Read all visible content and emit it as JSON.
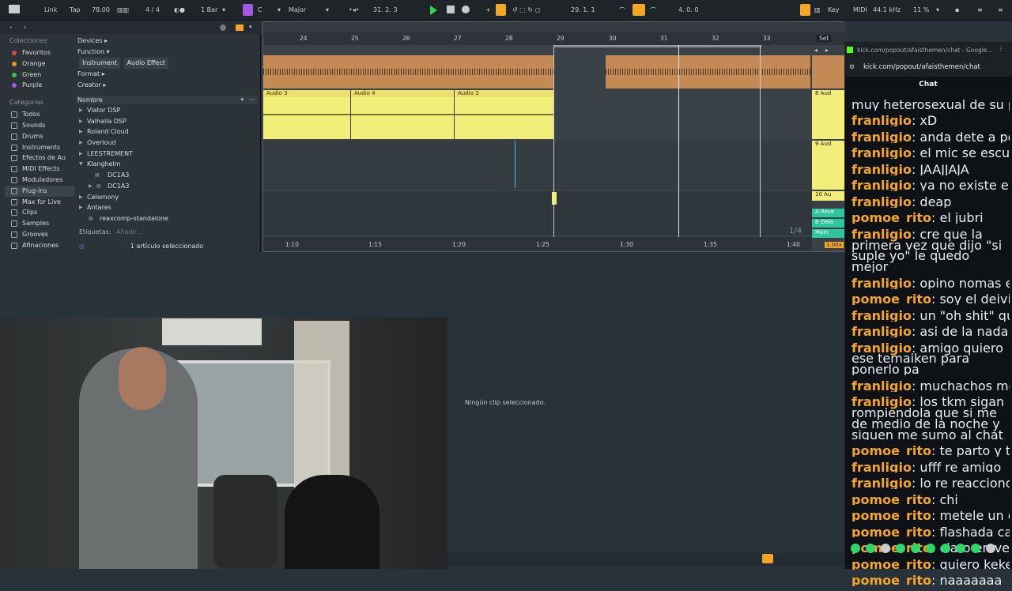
{
  "topbar": {
    "link": "Link",
    "tap": "Tap",
    "tempo": "78.00",
    "time_sig": "4 / 4",
    "quantize": "1 Bar",
    "key": "C",
    "scale": "Major",
    "position": "31.  2.  3",
    "loop_start": "29.  1.  1",
    "loop_length": "4.  0.  0",
    "key_label": "Key",
    "midi_label": "MIDI",
    "sample_rate": "44.1 kHz",
    "cpu": "11 %"
  },
  "browser": {
    "collections_title": "Colecciones",
    "collections": [
      {
        "label": "Favoritos",
        "color": "#e0443e"
      },
      {
        "label": "Orange",
        "color": "#f0922b"
      },
      {
        "label": "Green",
        "color": "#3cc24a"
      },
      {
        "label": "Purple",
        "color": "#a35ae0"
      }
    ],
    "categories_title": "Categorías",
    "categories": [
      "Todos",
      "Sounds",
      "Drums",
      "Instruments",
      "Efectos de Au",
      "MIDI Effects",
      "Moduladores",
      "Plug-ins",
      "Max for Live",
      "Clips",
      "Samples",
      "Grooves",
      "Afinaciones"
    ],
    "filters": {
      "devices": "Devices ▸",
      "function": "Function ▾",
      "chip_instrument": "Instrument",
      "chip_audio_effect": "Audio Effect",
      "format": "Format ▸",
      "creator": "Creator ▸"
    },
    "name_header": "Nombre",
    "tree": [
      "Viator DSP",
      "Valhalla DSP",
      "Roland Cloud",
      "Overloud",
      "LEESTREMENT",
      "Klanghelm",
      "DC1A3",
      "DC1A3",
      "Celemony",
      "Antares",
      "reaxcomp-standalone"
    ],
    "tags_label": "Etiquetas:",
    "tags_placeholder": "Añadir...",
    "selection_info": "1 artículo seleccionado"
  },
  "arrangement": {
    "bars": [
      "24",
      "25",
      "26",
      "27",
      "28",
      "29",
      "30",
      "31",
      "32",
      "33"
    ],
    "set_label": "Set",
    "clips": [
      "Audio 3",
      "Audio 4",
      "Audio 3"
    ],
    "times": [
      "1:10",
      "1:15",
      "1:20",
      "1:25",
      "1:30",
      "1:35",
      "1:40"
    ],
    "grid": "1/4",
    "tracks": [
      "8 Aud",
      "9 Aud",
      "10 Au",
      "A Reve",
      "B Dela",
      "Main"
    ],
    "zoom": "1.00x"
  },
  "chat": {
    "tab_title": "kick.com/popout/afaisthemen/chat - Google...",
    "url": "kick.com/popout/afaisthemen/chat",
    "title": "Chat",
    "messages": [
      {
        "user": "",
        "text": "muy heterosexual de su parte",
        "color": "#e9ecef"
      },
      {
        "user": "franligio",
        "text": "xD",
        "color": "#f5a623"
      },
      {
        "user": "franligio",
        "text": "anda dete a pelear dea",
        "color": "#f5a623"
      },
      {
        "user": "franligio",
        "text": "el mic se escucha un poco bajo pero va",
        "color": "#f5a623"
      },
      {
        "user": "franligio",
        "text": "JAAJJAJA",
        "color": "#f5a623"
      },
      {
        "user": "franligio",
        "text": "ya no existe el \"me debes un chicle\"???",
        "color": "#f5a623"
      },
      {
        "user": "franligio",
        "text": "deap",
        "color": "#f5a623"
      },
      {
        "user": "pomoe_rito",
        "text": "el jubri",
        "color": "#f5a623"
      },
      {
        "user": "franligio",
        "text": "cre que la primera vez que dijo \"si suple yo\" le quedo mejor",
        "color": "#f5a623"
      },
      {
        "user": "franligio",
        "text": "opino nomas eh",
        "color": "#f5a623"
      },
      {
        "user": "pomoe_rito",
        "text": "soy el deivid jubri bancando la tome",
        "color": "#f5a623"
      },
      {
        "user": "franligio",
        "text": "un \"oh shit\" quedaria epic ehhhh",
        "color": "#f5a623"
      },
      {
        "user": "franligio",
        "text": "asi de la nada jajajja",
        "color": "#f5a623"
      },
      {
        "user": "franligio",
        "text": "amigo quiero ese temaiken para ponerlo pa",
        "color": "#f5a623"
      },
      {
        "user": "franligio",
        "text": "muchachos me voy a la gaver",
        "color": "#f5a623"
      },
      {
        "user": "franligio",
        "text": "los tkm sigan rompiendola que si me de medio de la noche y siguen me sumo al chat",
        "color": "#f5a623"
      },
      {
        "user": "pomoe_rito",
        "text": "te parto y te derretis mi chocolate en",
        "color": "#f5a623"
      },
      {
        "user": "franligio",
        "text": "ufff re amigo",
        "color": "#f5a623"
      },
      {
        "user": "franligio",
        "text": "lo re reacciono",
        "color": "#f5a623"
      },
      {
        "user": "pomoe_rito",
        "text": "chi",
        "color": "#f5a623"
      },
      {
        "user": "pomoe_rito",
        "text": "metele un espacio despues del chi",
        "color": "#f5a623"
      },
      {
        "user": "pomoe_rito",
        "text": "flashada capaz",
        "color": "#f5a623"
      },
      {
        "user": "pomoe_rito",
        "text": "claro en vez de cortarlo correlo",
        "color": "#f5a623"
      },
      {
        "user": "pomoe_rito",
        "text": "quiero keke",
        "color": "#f5a623"
      },
      {
        "user": "pomoe_rito",
        "text": "naaaaaaa",
        "color": "#f5a623"
      }
    ]
  },
  "detail": {
    "no_clip": "Ningún clip seleccionado."
  },
  "colors": {
    "accent_yellow": "#f5a623",
    "clip_orange": "#c48a56",
    "clip_yellow": "#f2ee7a",
    "play_green": "#35d247",
    "kick_green": "#53fc18"
  }
}
